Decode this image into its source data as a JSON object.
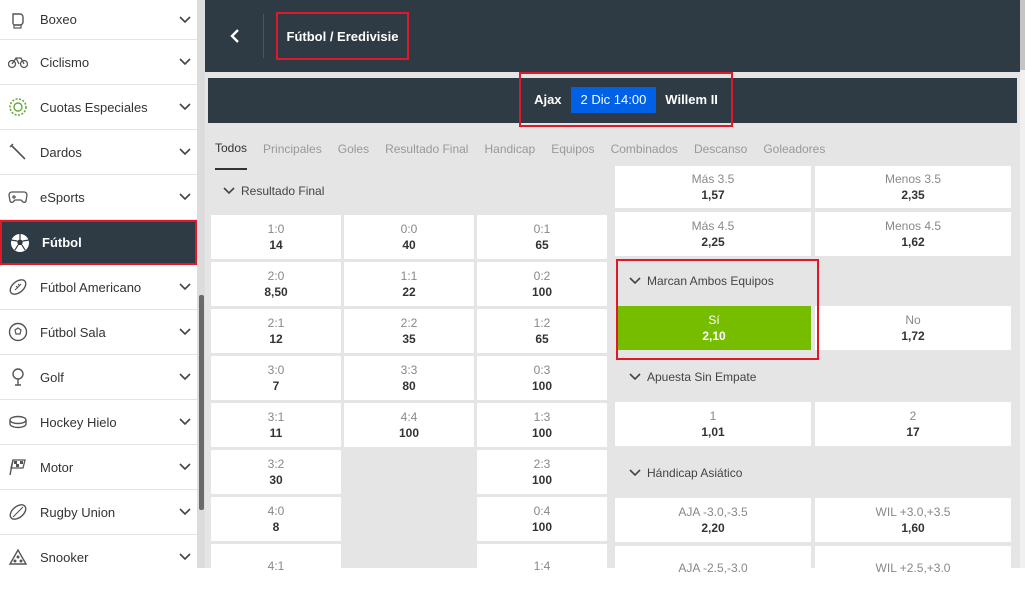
{
  "sidebar": {
    "items": [
      {
        "label": "Boxeo",
        "icon": "boxing-glove-icon"
      },
      {
        "label": "Ciclismo",
        "icon": "bicycle-icon"
      },
      {
        "label": "Cuotas Especiales",
        "icon": "special-odds-icon"
      },
      {
        "label": "Dardos",
        "icon": "dart-icon"
      },
      {
        "label": "eSports",
        "icon": "gamepad-icon"
      },
      {
        "label": "Fútbol",
        "icon": "soccer-ball-icon"
      },
      {
        "label": "Fútbol Americano",
        "icon": "american-football-icon"
      },
      {
        "label": "Fútbol Sala",
        "icon": "futsal-ball-icon"
      },
      {
        "label": "Golf",
        "icon": "golf-icon"
      },
      {
        "label": "Hockey Hielo",
        "icon": "hockey-puck-icon"
      },
      {
        "label": "Motor",
        "icon": "checkered-flag-icon"
      },
      {
        "label": "Rugby Union",
        "icon": "rugby-ball-icon"
      },
      {
        "label": "Snooker",
        "icon": "snooker-icon"
      }
    ],
    "active_index": 5
  },
  "header": {
    "title": "Fútbol / Eredivisie"
  },
  "match": {
    "home": "Ajax",
    "time": "2 Dic 14:00",
    "away": "Willem II"
  },
  "tabs": [
    "Todos",
    "Principales",
    "Goles",
    "Resultado Final",
    "Handicap",
    "Equipos",
    "Combinados",
    "Descanso",
    "Goleadores"
  ],
  "resultado_final": {
    "title": "Resultado Final",
    "rows": [
      [
        {
          "l": "1:0",
          "o": "14"
        },
        {
          "l": "0:0",
          "o": "40"
        },
        {
          "l": "0:1",
          "o": "65"
        }
      ],
      [
        {
          "l": "2:0",
          "o": "8,50"
        },
        {
          "l": "1:1",
          "o": "22"
        },
        {
          "l": "0:2",
          "o": "100"
        }
      ],
      [
        {
          "l": "2:1",
          "o": "12"
        },
        {
          "l": "2:2",
          "o": "35"
        },
        {
          "l": "1:2",
          "o": "65"
        }
      ],
      [
        {
          "l": "3:0",
          "o": "7"
        },
        {
          "l": "3:3",
          "o": "80"
        },
        {
          "l": "0:3",
          "o": "100"
        }
      ],
      [
        {
          "l": "3:1",
          "o": "11"
        },
        {
          "l": "4:4",
          "o": "100"
        },
        {
          "l": "1:3",
          "o": "100"
        }
      ],
      [
        {
          "l": "3:2",
          "o": "30"
        },
        null,
        {
          "l": "2:3",
          "o": "100"
        }
      ],
      [
        {
          "l": "4:0",
          "o": "8"
        },
        null,
        {
          "l": "0:4",
          "o": "100"
        }
      ],
      [
        {
          "l": "4:1",
          "o": ""
        },
        null,
        {
          "l": "1:4",
          "o": ""
        }
      ]
    ]
  },
  "goles": {
    "rows": [
      [
        {
          "l": "Más 3.5",
          "o": "1,57"
        },
        {
          "l": "Menos 3.5",
          "o": "2,35"
        }
      ],
      [
        {
          "l": "Más 4.5",
          "o": "2,25"
        },
        {
          "l": "Menos 4.5",
          "o": "1,62"
        }
      ]
    ]
  },
  "ambos_equipos": {
    "title": "Marcan Ambos Equipos",
    "options": [
      {
        "l": "Sí",
        "o": "2,10"
      },
      {
        "l": "No",
        "o": "1,72"
      }
    ]
  },
  "sin_empate": {
    "title": "Apuesta Sin Empate",
    "options": [
      {
        "l": "1",
        "o": "1,01"
      },
      {
        "l": "2",
        "o": "17"
      }
    ]
  },
  "handicap_asiatico": {
    "title": "Hándicap Asiático",
    "rows": [
      [
        {
          "l": "AJA -3.0,-3.5",
          "o": "2,20"
        },
        {
          "l": "WIL +3.0,+3.5",
          "o": "1,60"
        }
      ],
      [
        {
          "l": "AJA -2.5,-3.0",
          "o": ""
        },
        {
          "l": "WIL +2.5,+3.0",
          "o": ""
        }
      ]
    ]
  },
  "colors": {
    "dark": "#2e3a44",
    "highlight": "#e0192a",
    "time_badge": "#0060e6",
    "selected": "#76bd00"
  }
}
